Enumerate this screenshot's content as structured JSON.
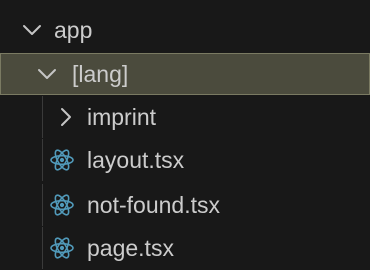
{
  "tree": {
    "root": {
      "label": "app",
      "icon": "chevron-down-icon"
    },
    "folder": {
      "label": "[lang]",
      "icon": "chevron-down-icon",
      "selected": true
    },
    "subfolder": {
      "label": "imprint",
      "icon": "chevron-right-icon"
    },
    "files": [
      {
        "label": "layout.tsx",
        "icon": "react-icon"
      },
      {
        "label": "not-found.tsx",
        "icon": "react-icon"
      },
      {
        "label": "page.tsx",
        "icon": "react-icon"
      }
    ]
  },
  "colors": {
    "background": "#181818",
    "selected_row": "#4b4b3d",
    "text": "#cccccc",
    "react_icon": "#519aba"
  }
}
